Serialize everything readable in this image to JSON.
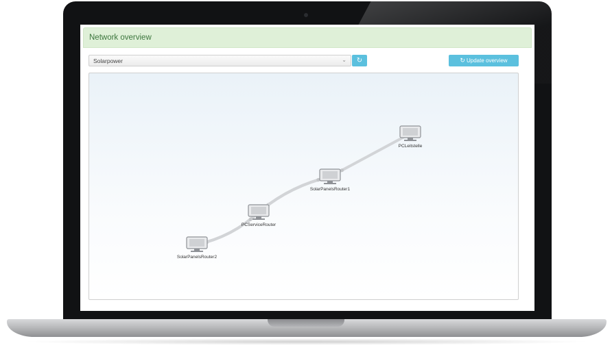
{
  "panel": {
    "title": "Network overview"
  },
  "toolbar": {
    "network_select_value": "Solarpower",
    "refresh_icon": "refresh-icon",
    "update_label": "Update overview",
    "accent_color": "#5bc0de",
    "header_color": "#dff0d8"
  },
  "graph": {
    "nodes": [
      {
        "label": "PCLeitstelle",
        "icon": "computer-icon"
      },
      {
        "label": "SolarPanelsRouter1",
        "icon": "computer-icon"
      },
      {
        "label": "PCServiceRouter",
        "icon": "computer-icon"
      },
      {
        "label": "SolarPanelsRouter2",
        "icon": "computer-icon"
      }
    ],
    "edges": [
      {
        "from": "PCLeitstelle",
        "to": "SolarPanelsRouter1"
      },
      {
        "from": "SolarPanelsRouter1",
        "to": "PCServiceRouter"
      },
      {
        "from": "PCServiceRouter",
        "to": "SolarPanelsRouter1"
      },
      {
        "from": "PCServiceRouter",
        "to": "SolarPanelsRouter2"
      },
      {
        "from": "SolarPanelsRouter2",
        "to": "PCServiceRouter"
      }
    ]
  }
}
